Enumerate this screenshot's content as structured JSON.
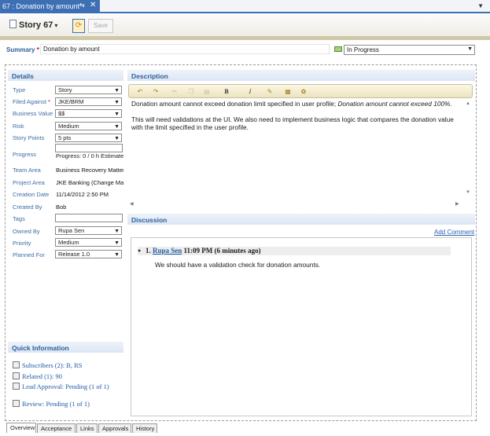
{
  "editor_tab": {
    "title": "67 : Donation by amount",
    "pin_glyph": "⇆",
    "close_glyph": "✕"
  },
  "header": {
    "story_label": "Story 67",
    "save_label": "Save"
  },
  "summary": {
    "label": "Summary",
    "required_mark": "*",
    "value": "Donation by amount"
  },
  "state": {
    "value": "In Progress"
  },
  "details": {
    "heading": "Details",
    "type": {
      "label": "Type",
      "value": "Story"
    },
    "filed_against": {
      "label": "Filed Against",
      "required_mark": "*",
      "value": "JKE/BRM"
    },
    "business_value": {
      "label": "Business Value",
      "value": "$$"
    },
    "risk": {
      "label": "Risk",
      "value": "Medium"
    },
    "story_points": {
      "label": "Story Points",
      "value": "5 pts"
    },
    "progress": {
      "label": "Progress",
      "text": "Progress: 0 / 0 h  Estimate"
    },
    "team_area": {
      "label": "Team Area",
      "value": "Business Recovery Matter"
    },
    "project_area": {
      "label": "Project Area",
      "value": "JKE Banking (Change Mar"
    },
    "creation_date": {
      "label": "Creation Date",
      "value": "11/14/2012 2:50 PM"
    },
    "created_by": {
      "label": "Created By",
      "value": "Bob"
    },
    "tags": {
      "label": "Tags",
      "value": ""
    },
    "owned_by": {
      "label": "Owned By",
      "value": "Rupa Sen"
    },
    "priority": {
      "label": "Priority",
      "value": "Medium"
    },
    "planned_for": {
      "label": "Planned For",
      "value": "Release 1.0"
    }
  },
  "quick_info": {
    "heading": "Quick Information",
    "items": [
      "Subscribers (2): B, RS",
      "Related (1): 90",
      "Lead Approval: Pending (1 of 1)",
      "Review: Pending (1 of 1)"
    ]
  },
  "description": {
    "heading": "Description",
    "para1_text": "Donation amount cannot exceed donation limit specified in user profile; ",
    "para1_italic": "Donation amount cannot exceed 100%.",
    "para2": "This will need validations at the UI. We also need to implement business logic that compares the donation value with the limit specified in the user profile.",
    "toolbar": {
      "bold": "B",
      "italic": "I"
    }
  },
  "discussion": {
    "heading": "Discussion",
    "add_comment": "Add Comment",
    "comments": [
      {
        "number": "1.",
        "author": "Rupa Sen",
        "time": "11:09 PM (6 minutes ago)",
        "text": "We should have a validation check for donation amounts."
      }
    ]
  },
  "bottom_tabs": [
    "Overview",
    "Acceptance",
    "Links",
    "Approvals",
    "History"
  ]
}
